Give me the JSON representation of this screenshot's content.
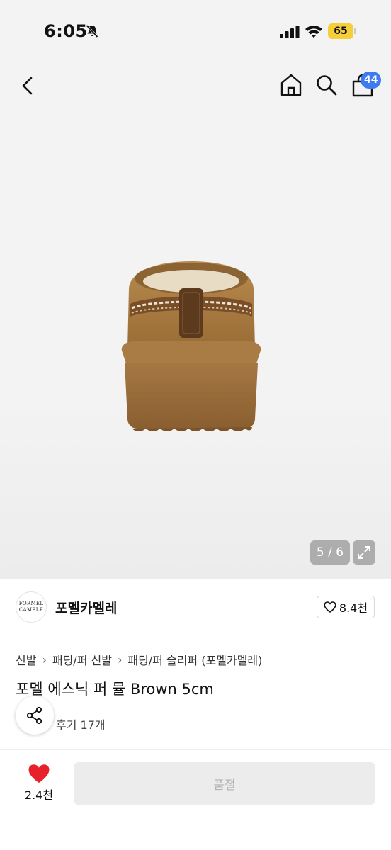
{
  "status_bar": {
    "time": "6:05",
    "battery": "65"
  },
  "nav": {
    "cart_badge": "44"
  },
  "gallery": {
    "counter": "5 / 6"
  },
  "brand": {
    "logo_line1": "FORMEL",
    "logo_line2": "CAMELE",
    "name": "포멜카멜레",
    "like_count": "8.4천"
  },
  "breadcrumb": {
    "items": [
      "신발",
      "패딩/퍼 신발",
      "패딩/퍼 슬리퍼 (포멜카멜레)"
    ]
  },
  "product": {
    "title": "포멜 에스닉 퍼 뮬 Brown 5cm",
    "review_link": "후기 17개"
  },
  "bottom_bar": {
    "wish_count": "2.4천",
    "buy_button": "품절"
  },
  "colors": {
    "badge": "#3d7cf0",
    "heart": "#e8202a",
    "battery": "#f5cf3a",
    "soldout_bg": "#ececec"
  }
}
